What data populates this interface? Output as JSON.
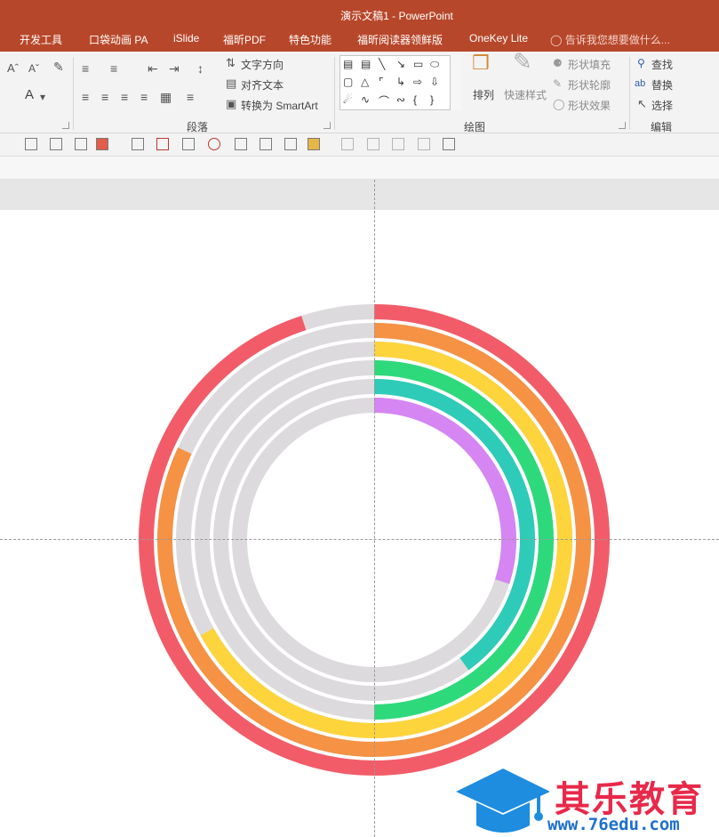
{
  "window": {
    "title": "演示文稿1 - PowerPoint"
  },
  "tabs": [
    "开发工具",
    "口袋动画 PA",
    "iSlide",
    "福昕PDF",
    "特色功能",
    "福昕阅读器领鲜版",
    "OneKey Lite"
  ],
  "tell_me": "告诉我您想要做什么...",
  "ribbon": {
    "paragraph": {
      "label": "段落",
      "text_direction": "文字方向",
      "align_text": "对齐文本",
      "convert_smartart": "转换为 SmartArt"
    },
    "drawing": {
      "label": "绘图",
      "arrange": "排列",
      "quick_styles": "快速样式",
      "shape_fill": "形状填充",
      "shape_outline": "形状轮廓",
      "shape_effects": "形状效果"
    },
    "editing": {
      "label": "编辑",
      "find": "查找",
      "replace": "替换",
      "select": "选择"
    },
    "font_size_up": "A",
    "font_size_down": "A",
    "font_color": "A"
  },
  "chart_data": {
    "type": "radial-bar",
    "track_color": "#dcdadc",
    "series": [
      {
        "color": "#f25c69",
        "fraction": 0.95
      },
      {
        "color": "#f59244",
        "fraction": 0.82
      },
      {
        "color": "#fdd43c",
        "fraction": 0.67
      },
      {
        "color": "#2ed97c",
        "fraction": 0.5
      },
      {
        "color": "#2ecbb8",
        "fraction": 0.4
      },
      {
        "color": "#d586f2",
        "fraction": 0.3
      }
    ]
  },
  "watermark": {
    "name": "其乐教育",
    "url": "www.76edu.com"
  }
}
